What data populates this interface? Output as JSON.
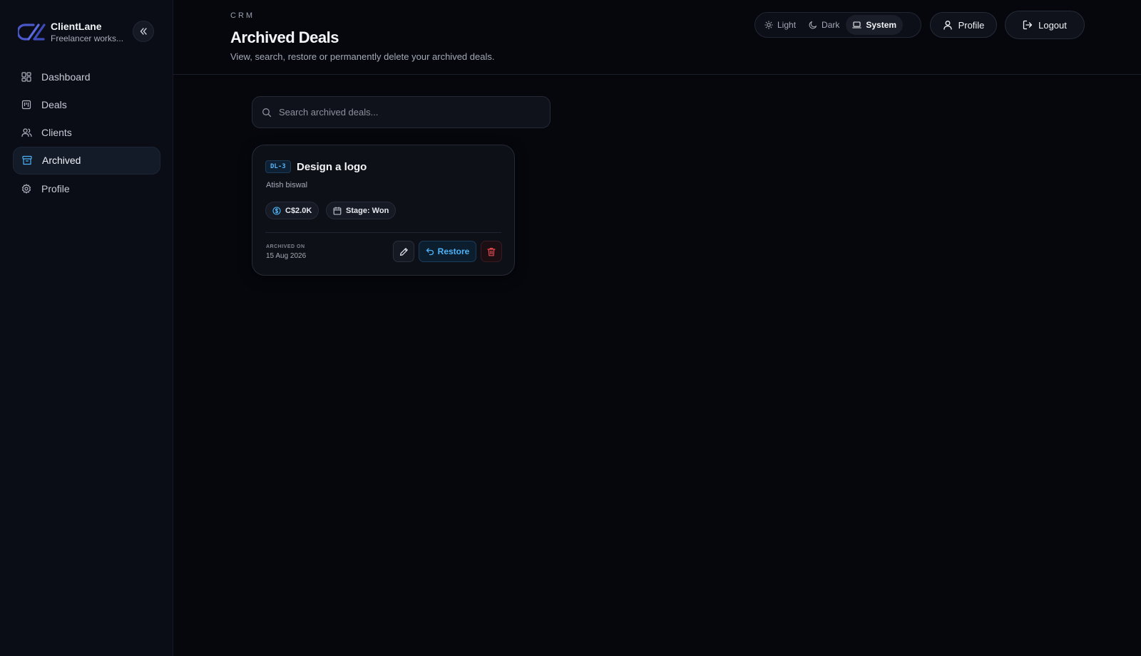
{
  "brand": {
    "name": "ClientLane",
    "subtitle": "Freelancer works..."
  },
  "sidebar": {
    "items": [
      {
        "label": "Dashboard",
        "icon": "dashboard-icon",
        "active": false
      },
      {
        "label": "Deals",
        "icon": "deals-icon",
        "active": false
      },
      {
        "label": "Clients",
        "icon": "users-icon",
        "active": false
      },
      {
        "label": "Archived",
        "icon": "archive-icon",
        "active": true
      },
      {
        "label": "Profile",
        "icon": "gear-icon",
        "active": false
      }
    ]
  },
  "header": {
    "section": "CRM",
    "title": "Archived Deals",
    "subtitle": "View, search, restore or permanently delete your archived deals.",
    "theme_options": [
      {
        "label": "Light",
        "icon": "sun-icon",
        "selected": false
      },
      {
        "label": "Dark",
        "icon": "moon-icon",
        "selected": false
      },
      {
        "label": "System",
        "icon": "laptop-icon",
        "selected": true
      }
    ],
    "profile_label": "Profile",
    "logout_label": "Logout"
  },
  "search": {
    "placeholder": "Search archived deals...",
    "value": ""
  },
  "deals": [
    {
      "code": "DL-3",
      "title": "Design a logo",
      "client": "Atish biswal",
      "value": "C$2.0K",
      "stage": "Stage: Won",
      "archived_label": "ARCHIVED ON",
      "archived_date": "15 Aug 2026",
      "restore_label": "Restore"
    }
  ],
  "colors": {
    "background": "#05070d",
    "sidebar": "#0a0d16",
    "accent": "#4db3f6",
    "danger": "#e5484d"
  }
}
